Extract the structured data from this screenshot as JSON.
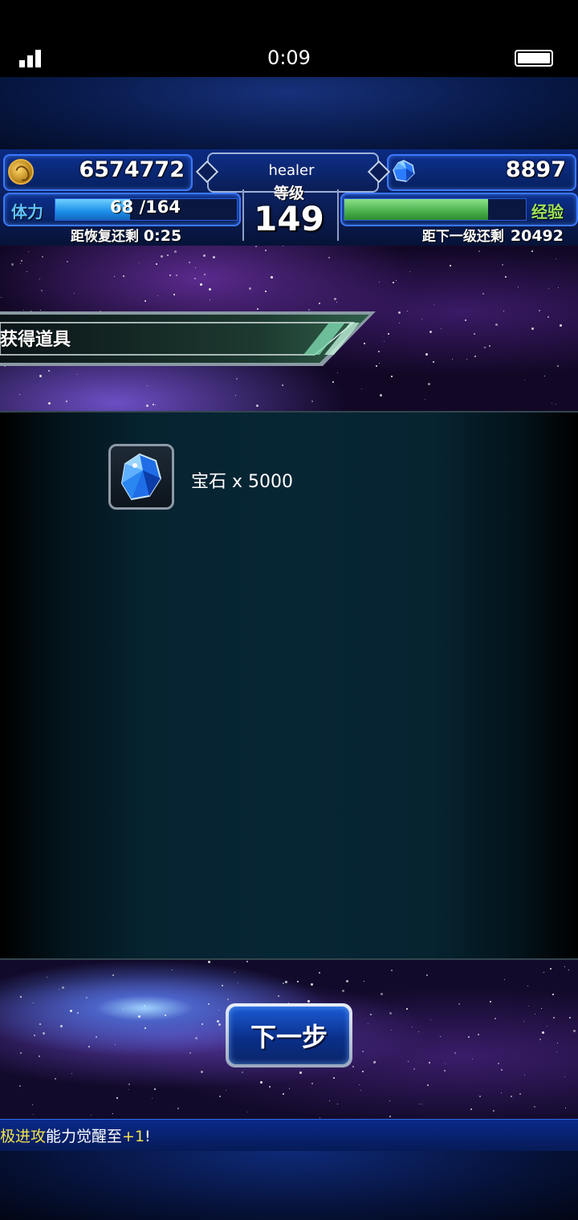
{
  "status": {
    "time": "0:09"
  },
  "header": {
    "gold": "6574772",
    "gems": "8897",
    "username": "healer",
    "level_label": "等级",
    "level": "149",
    "stamina_label": "体力",
    "stamina_text": "68 /164",
    "stamina_fraction": 0.41,
    "recover_label": "距恢复还剩",
    "recover_time": "0:25",
    "exp_label": "经验",
    "exp_fraction": 0.79,
    "next_level_label": "距下一级还剩",
    "next_level_exp": "20492"
  },
  "rewards": {
    "title": "获得道具",
    "items": [
      {
        "icon": "gem-icon",
        "label": "宝石 x 5000"
      }
    ]
  },
  "next_button": {
    "label": "下一步"
  },
  "ticker": {
    "highlight": "极进攻",
    "mid": "能力觉醒至",
    "plus": "+1",
    "end": "!"
  },
  "colors": {
    "stamina": "#1c8ee8",
    "exp": "#49b04a",
    "accent": "#3a78ff",
    "ticker_highlight": "#f3e34a"
  }
}
